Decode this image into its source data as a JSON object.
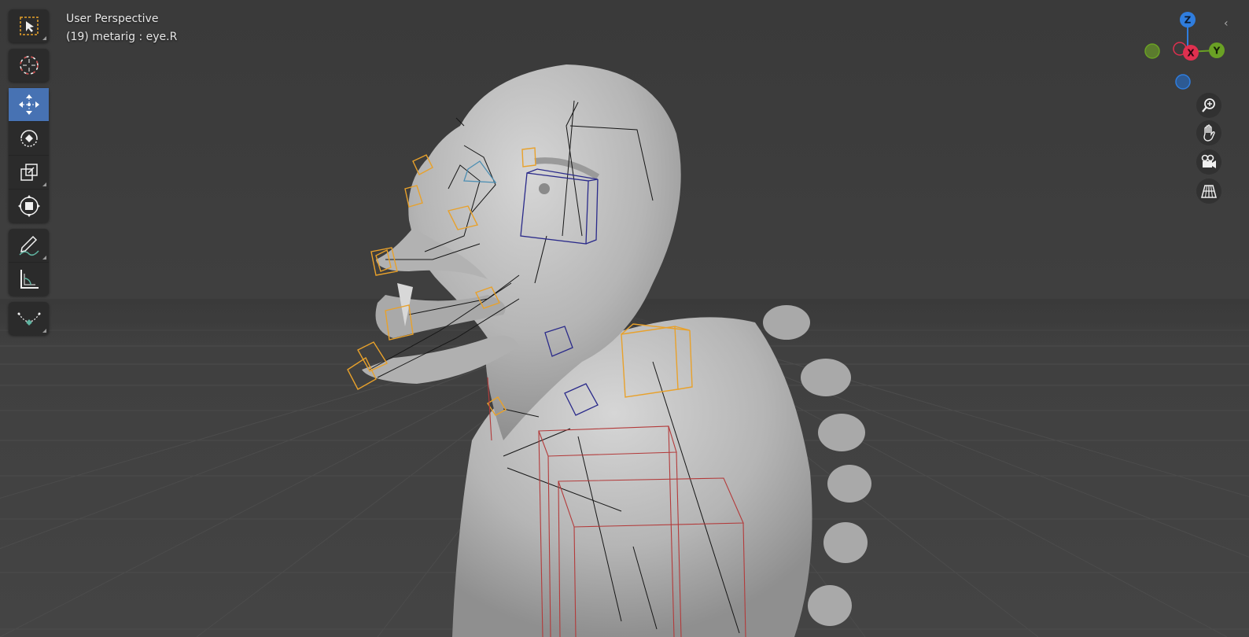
{
  "viewport": {
    "view_name": "User Perspective",
    "active_object": "(19) metarig : eye.R"
  },
  "toolbar": {
    "tools": [
      {
        "name": "select-box-tool",
        "icon": "select-box-icon",
        "active": false
      },
      {
        "name": "cursor-tool",
        "icon": "cursor-icon",
        "active": false
      },
      {
        "name": "move-tool",
        "icon": "move-icon",
        "active": true
      },
      {
        "name": "rotate-tool",
        "icon": "rotate-icon",
        "active": false
      },
      {
        "name": "scale-tool",
        "icon": "scale-icon",
        "active": false
      },
      {
        "name": "transform-tool",
        "icon": "transform-icon",
        "active": false
      },
      {
        "name": "annotate-tool",
        "icon": "annotate-icon",
        "active": false
      },
      {
        "name": "measure-tool",
        "icon": "measure-icon",
        "active": false
      },
      {
        "name": "bone-roll-tool",
        "icon": "bone-roll-icon",
        "active": false
      }
    ]
  },
  "gizmo": {
    "axes": [
      {
        "label": "Z",
        "color": "#2f7dde"
      },
      {
        "label": "X",
        "color": "#e0304f"
      },
      {
        "label": "Y",
        "color": "#6aa124"
      }
    ],
    "negative_colors": {
      "x": "#e0304f",
      "y": "#6aa124",
      "z": "#2f7dde"
    }
  },
  "navigation": [
    {
      "name": "zoom-button",
      "icon": "zoom-icon"
    },
    {
      "name": "pan-button",
      "icon": "hand-icon"
    },
    {
      "name": "camera-view-button",
      "icon": "camera-icon"
    },
    {
      "name": "perspective-toggle-button",
      "icon": "grid-icon"
    }
  ],
  "colors": {
    "active_tool": "#4772b3",
    "selected_bone": "#e8a12b",
    "bone_wire": "#1a1a1a",
    "deform_bone": "#c04040",
    "mesh": "#b8b8b8"
  }
}
